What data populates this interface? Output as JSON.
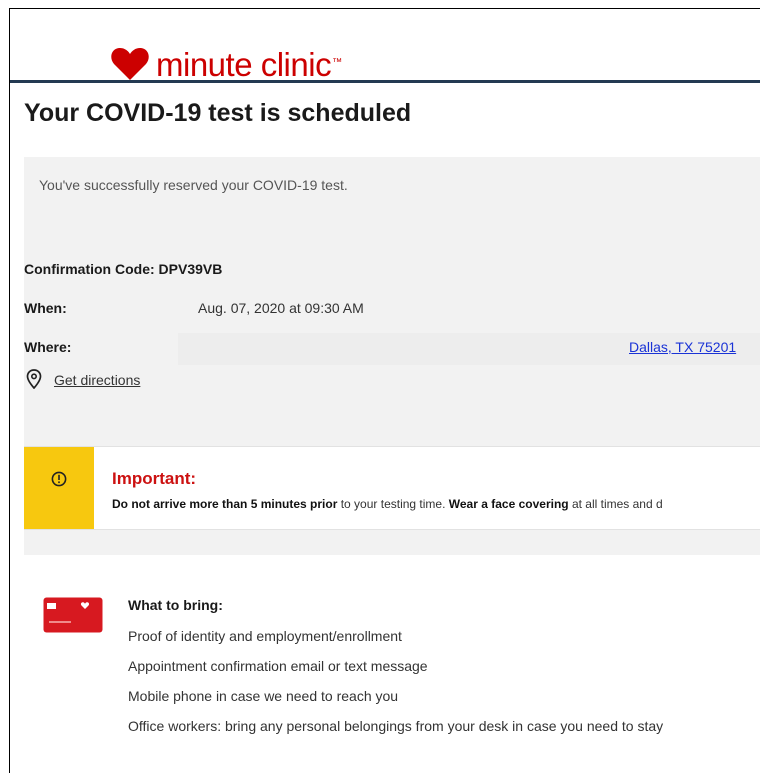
{
  "brand": {
    "logo_text": "minute clinic",
    "trademark": "™",
    "color": "#cc0000"
  },
  "page": {
    "title": "Your COVID-19 test is scheduled",
    "success_message": "You've successfully reserved your COVID-19 test."
  },
  "confirmation": {
    "label": "Confirmation Code:",
    "code": "DPV39VB"
  },
  "when": {
    "label": "When:",
    "value": "Aug. 07, 2020 at 09:30 AM"
  },
  "where": {
    "label": "Where:",
    "link_text": "Dallas, TX 75201"
  },
  "directions": {
    "icon": "map-pin-icon",
    "link_text": "Get directions"
  },
  "important": {
    "icon": "alert-circle-icon",
    "accent_color": "#f7c80f",
    "title": "Important:",
    "part1_bold": "Do not arrive more than 5 minutes prior",
    "part2": " to your testing time. ",
    "part3_bold": "Wear a face covering",
    "part4": " at all times and d"
  },
  "what_to_bring": {
    "icon": "id-card-icon",
    "title": "What to bring:",
    "items": [
      "Proof of identity and employment/enrollment",
      "Appointment confirmation email or text message",
      "Mobile phone in case we need to reach you",
      "Office workers: bring any personal belongings from your desk in case you need to stay"
    ]
  }
}
